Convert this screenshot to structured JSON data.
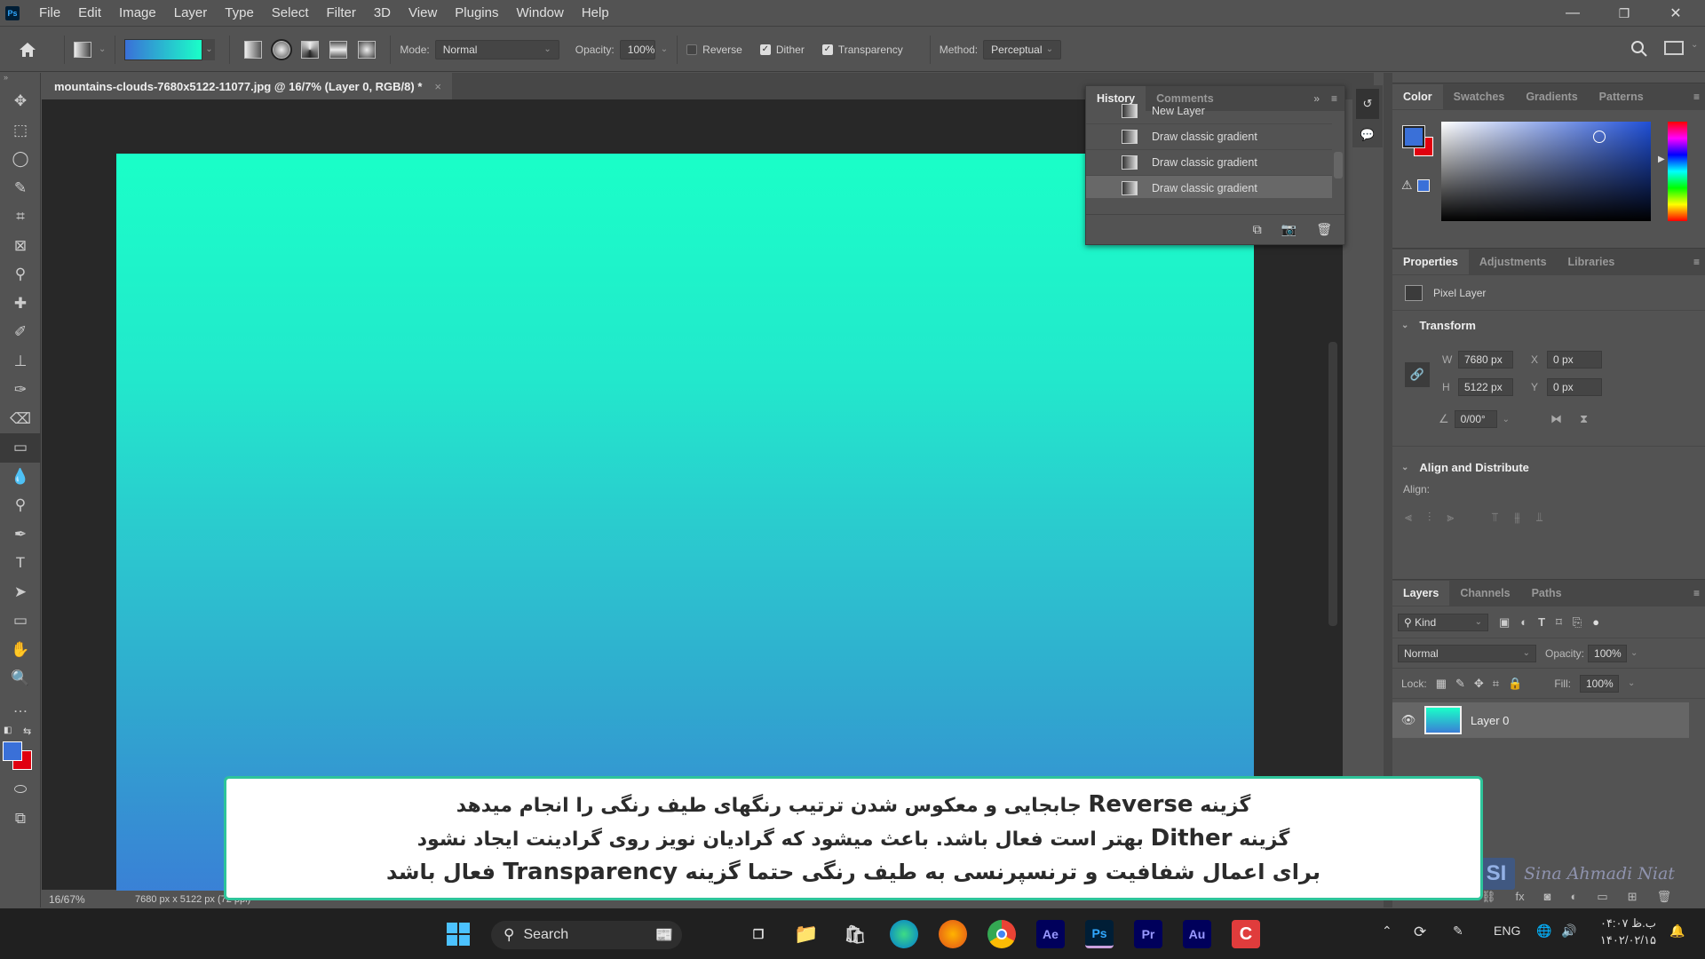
{
  "app": {
    "logo": "Ps",
    "menu": [
      "File",
      "Edit",
      "Image",
      "Layer",
      "Type",
      "Select",
      "Filter",
      "3D",
      "View",
      "Plugins",
      "Window",
      "Help"
    ],
    "window_controls": {
      "minimize": "—",
      "restore": "❐",
      "close": "✕"
    }
  },
  "options_bar": {
    "gradient_colors": [
      "#3a70d8",
      "#1affc8"
    ],
    "gradient_types": [
      "linear",
      "radial",
      "angle",
      "reflected",
      "diamond"
    ],
    "active_gradient_type": "radial",
    "mode_label": "Mode:",
    "mode_value": "Normal",
    "opacity_label": "Opacity:",
    "opacity_value": "100%",
    "reverse_label": "Reverse",
    "reverse_checked": false,
    "dither_label": "Dither",
    "dither_checked": true,
    "transparency_label": "Transparency",
    "transparency_checked": true,
    "method_label": "Method:",
    "method_value": "Perceptual"
  },
  "document": {
    "tab_title": "mountains-clouds-7680x5122-11077.jpg @ 16/7% (Layer 0, RGB/8) *",
    "close": "×",
    "canvas_gradient": [
      "#1affc8",
      "#3a7fd6"
    ],
    "zoom": "16/67%",
    "dimensions": "7680 px x 5122 px (72 ppi)"
  },
  "tools": [
    "move",
    "marquee",
    "lasso",
    "quick-select",
    "crop",
    "frame",
    "eyedropper",
    "healing",
    "brush",
    "stamp",
    "history-brush",
    "eraser",
    "gradient",
    "blur",
    "dodge",
    "pen",
    "type",
    "path-select",
    "rectangle",
    "hand",
    "zoom",
    "more"
  ],
  "tool_icons": [
    "✥",
    "⬚",
    "◯",
    "✎",
    "⌗",
    "⊠",
    "⚲",
    "✚",
    "✐",
    "⊥",
    "✑",
    "⌫",
    "▭",
    "💧",
    "⚲",
    "✒",
    "T",
    "➤",
    "▭",
    "✋",
    "🔍",
    "…"
  ],
  "colors": {
    "foreground": "#3a70d8",
    "background": "#e0000f"
  },
  "history": {
    "tabs": [
      "History",
      "Comments"
    ],
    "items": [
      {
        "label": "New Layer",
        "partial": true
      },
      {
        "label": "Draw classic gradient"
      },
      {
        "label": "Draw classic gradient"
      },
      {
        "label": "Draw classic gradient",
        "active": true
      }
    ]
  },
  "color_panel": {
    "tabs": [
      "Color",
      "Swatches",
      "Gradients",
      "Patterns"
    ],
    "picker_hue": "#1f4fd6"
  },
  "properties": {
    "tabs": [
      "Properties",
      "Adjustments",
      "Libraries"
    ],
    "kind": "Pixel Layer",
    "transform_title": "Transform",
    "w_label": "W",
    "w_value": "7680 px",
    "h_label": "H",
    "h_value": "5122 px",
    "x_label": "X",
    "x_value": "0 px",
    "y_label": "Y",
    "y_value": "0 px",
    "angle_value": "0/00°",
    "align_title": "Align and Distribute",
    "align_label": "Align:"
  },
  "layers": {
    "tabs": [
      "Layers",
      "Channels",
      "Paths"
    ],
    "filter_kind": "Kind",
    "blend_mode": "Normal",
    "opacity_label": "Opacity:",
    "opacity_value": "100%",
    "lock_label": "Lock:",
    "fill_label": "Fill:",
    "fill_value": "100%",
    "items": [
      {
        "name": "Layer 0",
        "visible": true
      }
    ]
  },
  "caption": {
    "line1_pre": "گزینه",
    "line1_en": "Reverse",
    "line1_post": "جابجایی و معکوس شدن ترتیب رنگهای طیف رنگی را انجام میدهد",
    "line2_pre": "گزینه",
    "line2_en": "Dither",
    "line2_post": "بهتر است فعال باشد. باعث میشود که گرادیان نویز روی گرادینت ایجاد نشود",
    "line3_pre": "برای اعمال شفافیت و ترنسپرنسی به طیف رنگی حتما گزینه",
    "line3_en": "Transparency",
    "line3_post": "فعال باشد"
  },
  "watermark": {
    "logo": "SI",
    "text": "Sina Ahmadi Niat"
  },
  "taskbar": {
    "search_placeholder": "Search",
    "apps": [
      "Ae",
      "Ps",
      "Pr",
      "Au"
    ],
    "language": "ENG",
    "time": "۰۴:۰۷ ب.ظ",
    "date": "۱۴۰۲/۰۲/۱۵"
  }
}
